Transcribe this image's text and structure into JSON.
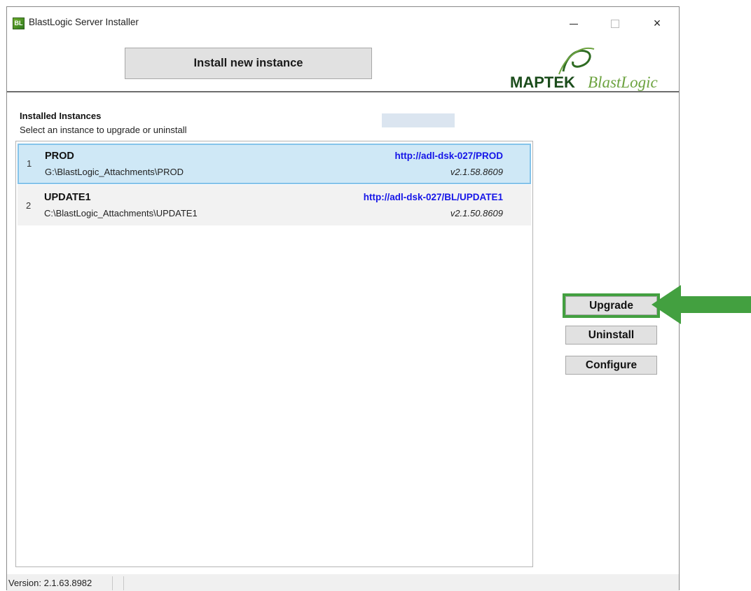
{
  "window": {
    "title": "BlastLogic Server Installer",
    "icon_text": "BL",
    "controls": {
      "minimize": "minimize-icon",
      "maximize": "maximize-icon",
      "close": "×"
    }
  },
  "header": {
    "install_button": "Install new instance",
    "logo": {
      "brand": "MAPTEK",
      "product": "BlastLogic"
    }
  },
  "installed": {
    "title": "Installed Instances",
    "subtitle": "Select an instance to upgrade or uninstall",
    "instances": [
      {
        "index": "1",
        "name": "PROD",
        "path": "G:\\BlastLogic_Attachments\\PROD",
        "url": "http://adl-dsk-027/PROD",
        "version": "v2.1.58.8609",
        "selected": true
      },
      {
        "index": "2",
        "name": "UPDATE1",
        "path": "C:\\BlastLogic_Attachments\\UPDATE1",
        "url": "http://adl-dsk-027/BL/UPDATE1",
        "version": "v2.1.50.8609",
        "selected": false
      }
    ]
  },
  "actions": {
    "upgrade": "Upgrade",
    "uninstall": "Uninstall",
    "configure": "Configure"
  },
  "status": {
    "version": "Version: 2.1.63.8982"
  },
  "colors": {
    "highlight": "#43a040",
    "selected_row": "#cfe8f6",
    "url": "#1515e8",
    "logo_text": "#1c4d1c"
  }
}
